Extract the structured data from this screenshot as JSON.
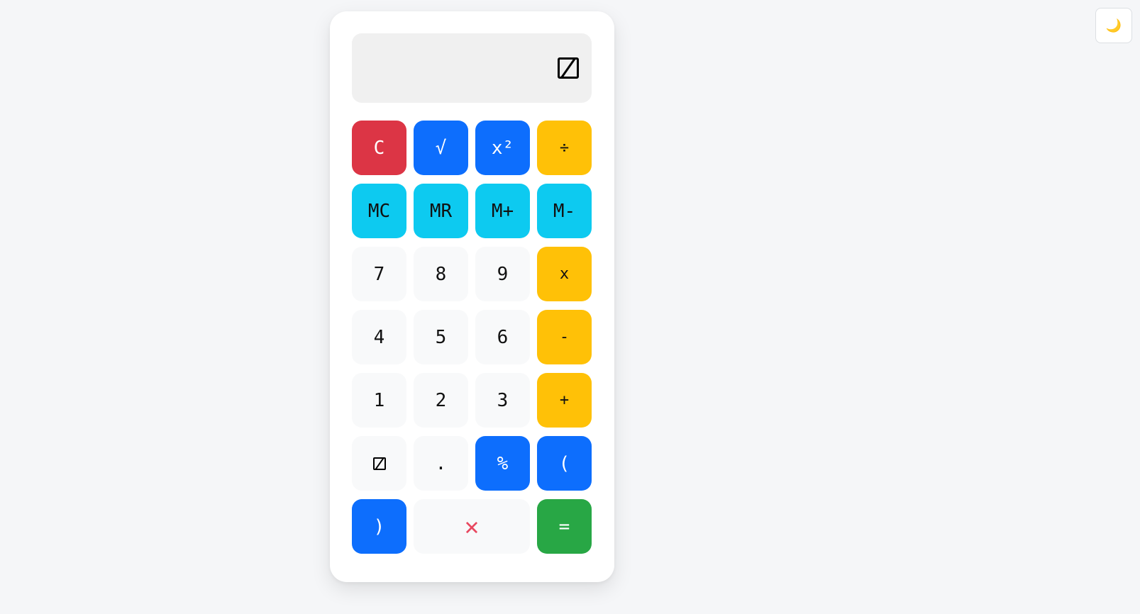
{
  "calculator": {
    "display": {
      "value": ""
    },
    "keys": [
      {
        "label": "C",
        "variant": "danger",
        "name": "clear-button"
      },
      {
        "label": "√",
        "variant": "primary",
        "name": "sqrt-button"
      },
      {
        "label": "x²",
        "variant": "primary",
        "name": "square-button"
      },
      {
        "label": "÷",
        "variant": "warning",
        "name": "divide-button"
      },
      {
        "label": "MC",
        "variant": "info",
        "name": "memory-clear-button"
      },
      {
        "label": "MR",
        "variant": "info",
        "name": "memory-recall-button"
      },
      {
        "label": "M+",
        "variant": "info",
        "name": "memory-add-button"
      },
      {
        "label": "M-",
        "variant": "info",
        "name": "memory-subtract-button"
      },
      {
        "label": "7",
        "variant": "num",
        "name": "digit-7-button"
      },
      {
        "label": "8",
        "variant": "num",
        "name": "digit-8-button"
      },
      {
        "label": "9",
        "variant": "num",
        "name": "digit-9-button"
      },
      {
        "label": "x",
        "variant": "warning",
        "name": "multiply-button"
      },
      {
        "label": "4",
        "variant": "num",
        "name": "digit-4-button"
      },
      {
        "label": "5",
        "variant": "num",
        "name": "digit-5-button"
      },
      {
        "label": "6",
        "variant": "num",
        "name": "digit-6-button"
      },
      {
        "label": "-",
        "variant": "warning",
        "name": "subtract-button"
      },
      {
        "label": "1",
        "variant": "num",
        "name": "digit-1-button"
      },
      {
        "label": "2",
        "variant": "num",
        "name": "digit-2-button"
      },
      {
        "label": "3",
        "variant": "num",
        "name": "digit-3-button"
      },
      {
        "label": "+",
        "variant": "warning",
        "name": "add-button"
      },
      {
        "label": "0",
        "variant": "num",
        "name": "digit-0-button"
      },
      {
        "label": ".",
        "variant": "num",
        "name": "decimal-button"
      },
      {
        "label": "%",
        "variant": "primary",
        "name": "percent-button"
      },
      {
        "label": "(",
        "variant": "primary",
        "name": "open-paren-button"
      },
      {
        "label": ")",
        "variant": "primary",
        "name": "close-paren-button"
      },
      {
        "label": "✕",
        "variant": "backspace",
        "name": "backspace-button",
        "wide": true,
        "icon": "close-icon"
      },
      {
        "label": "=",
        "variant": "success",
        "name": "equals-button"
      }
    ]
  },
  "theme_toggle": {
    "icon": "moon-icon",
    "label": "🌙"
  },
  "colors": {
    "danger": "#dc3545",
    "primary": "#0d6efd",
    "warning": "#ffc107",
    "info": "#0dcaf0",
    "success": "#28a745",
    "number": "#f8f9fa",
    "display": "#f0f0f0",
    "background": "#f5f6f8"
  }
}
